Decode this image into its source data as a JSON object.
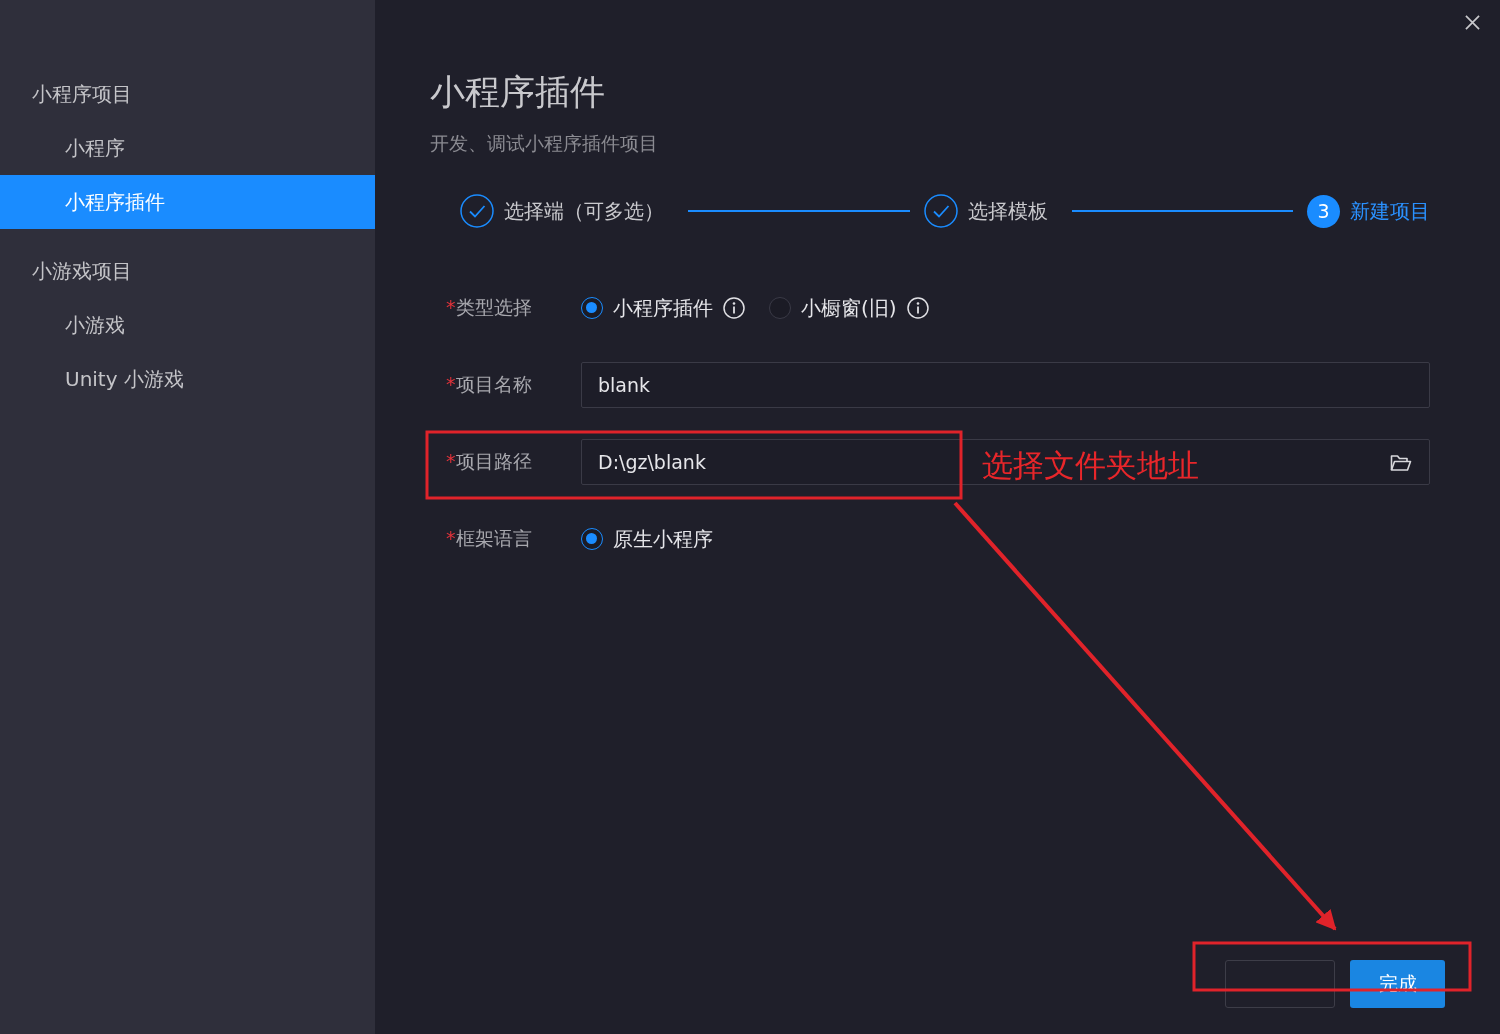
{
  "sidebar": {
    "groups": [
      {
        "label": "小程序项目",
        "children": [
          {
            "label": "小程序",
            "selected": false
          },
          {
            "label": "小程序插件",
            "selected": true
          }
        ]
      },
      {
        "label": "小游戏项目",
        "children": [
          {
            "label": "小游戏",
            "selected": false
          },
          {
            "label": "Unity 小游戏",
            "selected": false
          }
        ]
      }
    ]
  },
  "header": {
    "title": "小程序插件",
    "subtitle": "开发、调试小程序插件项目"
  },
  "steps": [
    {
      "label": "选择端（可多选）",
      "done": true,
      "active": false
    },
    {
      "label": "选择模板",
      "done": true,
      "active": false
    },
    {
      "label": "新建项目",
      "number": "3",
      "done": false,
      "active": true
    }
  ],
  "form": {
    "fields": [
      {
        "kind": "radio",
        "required_mark": "*",
        "label": "类型选择",
        "options": [
          {
            "label": "小程序插件",
            "selected": true,
            "info": true
          },
          {
            "label": "小橱窗(旧)",
            "selected": false,
            "info": true
          }
        ]
      },
      {
        "kind": "text",
        "required_mark": "*",
        "label": "项目名称",
        "value": "blank"
      },
      {
        "kind": "path",
        "required_mark": "*",
        "label": "项目路径",
        "value": "D:\\gz\\blank"
      },
      {
        "kind": "radio",
        "required_mark": "*",
        "label": "框架语言",
        "options": [
          {
            "label": "原生小程序",
            "selected": true
          }
        ]
      }
    ]
  },
  "buttons": [
    {
      "kind": "secondary"
    },
    {
      "kind": "primary",
      "label": "完成"
    }
  ],
  "annotation": {
    "note": "选择文件夹地址"
  }
}
